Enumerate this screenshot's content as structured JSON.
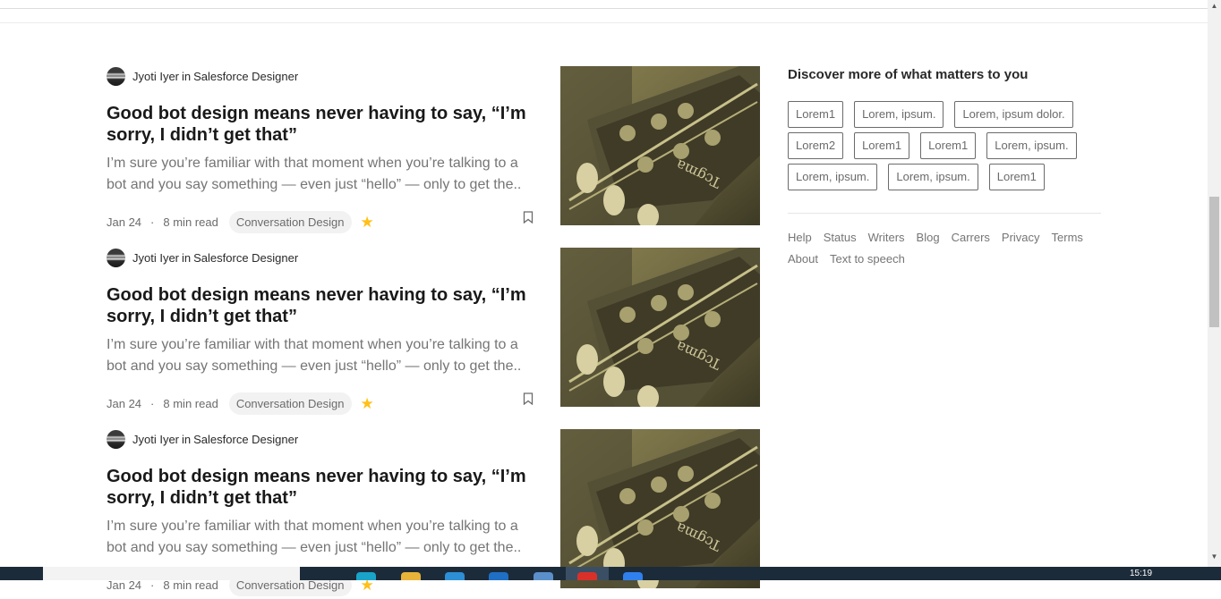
{
  "articles": [
    {
      "author": "Jyoti Iyer",
      "in_word": "in",
      "publication": "Salesforce Designer",
      "title": "Good bot design means never having to say, “I’m sorry, I didn’t get that”",
      "excerpt": "I’m sure you’re familiar with that moment when you’re talking to a bot and you say something — even just “hello” — only to get the..",
      "date": "Jan 24",
      "read_time": "8 min read",
      "tag": "Conversation Design"
    },
    {
      "author": "Jyoti Iyer",
      "in_word": "in",
      "publication": "Salesforce Designer",
      "title": "Good bot design means never having to say, “I’m sorry, I didn’t get that”",
      "excerpt": "I’m sure you’re familiar with that moment when you’re talking to a bot and you say something — even just “hello” — only to get the..",
      "date": "Jan 24",
      "read_time": "8 min read",
      "tag": "Conversation Design"
    },
    {
      "author": "Jyoti Iyer",
      "in_word": "in",
      "publication": "Salesforce Designer",
      "title": "Good bot design means never having to say, “I’m sorry, I didn’t get that”",
      "excerpt": "I’m sure you’re familiar with that moment when you’re talking to a bot and you say something — even just “hello” — only to get the..",
      "date": "Jan 24",
      "read_time": "8 min read",
      "tag": "Conversation Design"
    }
  ],
  "sidebar": {
    "title": "Discover more of what matters to you",
    "topics": [
      "Lorem1",
      "Lorem, ipsum.",
      "Lorem, ipsum dolor.",
      "Lorem2",
      "Lorem1",
      "Lorem1",
      "Lorem, ipsum.",
      "Lorem, ipsum.",
      "Lorem, ipsum.",
      "Lorem1"
    ],
    "footer_links": [
      "Help",
      "Status",
      "Writers",
      "Blog",
      "Carrers",
      "Privacy",
      "Terms",
      "About",
      "Text to speech"
    ]
  },
  "meta_separator": "·",
  "taskbar": {
    "clock": "15:19"
  },
  "colors": {
    "star": "#ffc017",
    "title": "#191919",
    "muted": "#757575",
    "taskbar": "#1c2b3a"
  },
  "icons": {
    "star": "star-icon",
    "bookmark": "bookmark-icon",
    "avatar": "avatar"
  }
}
